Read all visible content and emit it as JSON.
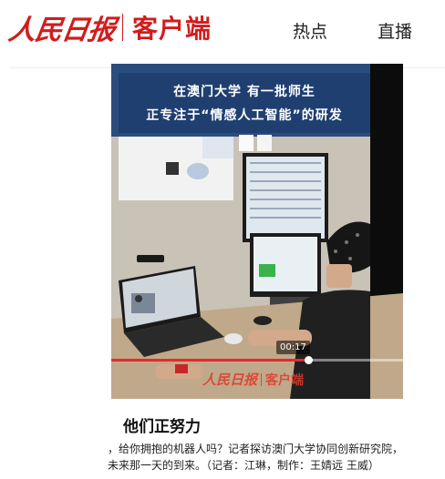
{
  "header": {
    "logo_mark": "人民日报",
    "logo_sub": "客户端",
    "nav": [
      "热点",
      "直播"
    ]
  },
  "video": {
    "caption_lines": [
      "在澳门大学 有一批师生",
      "正专注于“情感人工智能”的研发"
    ],
    "current_time": "00:17",
    "progress": 0.675,
    "watermark_mark": "人民日报",
    "watermark_sub": "客户端"
  },
  "article": {
    "title": "他们正努力",
    "desc_line1": "，给你拥抱的机器人吗？记者探访澳门大学协同创新研究院，",
    "desc_line2": "未来那一天的到来。（记者：江琳，制作：王婧远 王威）"
  },
  "colors": {
    "brand_red": "#d21c1c",
    "caption_band": "#1f3f70",
    "progress_fill": "#e52a2a"
  }
}
